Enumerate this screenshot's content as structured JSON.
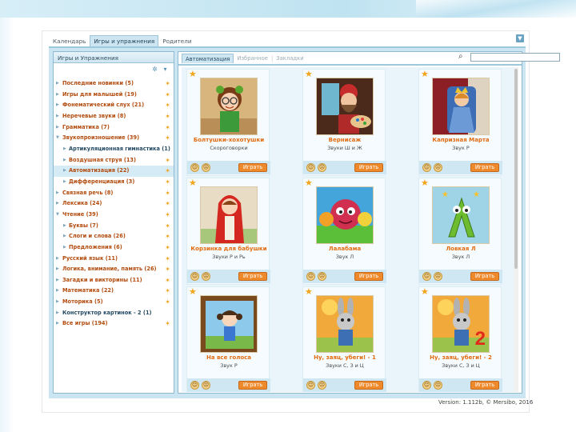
{
  "tabs": [
    "Календарь",
    "Игры и упражнения",
    "Родители"
  ],
  "help_label": "▼",
  "left_panel": {
    "title": "Игры и Упражнения",
    "items": [
      {
        "label": "Последние новинки (5)",
        "level": 0,
        "expanded": false,
        "star": true,
        "dark": false
      },
      {
        "label": "Игры для малышей (19)",
        "level": 0,
        "expanded": false,
        "star": true,
        "dark": false
      },
      {
        "label": "Фонематический слух (21)",
        "level": 0,
        "expanded": false,
        "star": true,
        "dark": false
      },
      {
        "label": "Неречевые звуки (8)",
        "level": 0,
        "expanded": false,
        "star": true,
        "dark": false
      },
      {
        "label": "Грамматика (7)",
        "level": 0,
        "expanded": false,
        "star": true,
        "dark": false
      },
      {
        "label": "Звукопроизношение (39)",
        "level": 0,
        "expanded": true,
        "star": true,
        "dark": false
      },
      {
        "label": "Артикуляционная гимнастика (1)",
        "level": 1,
        "expanded": false,
        "star": false,
        "dark": true
      },
      {
        "label": "Воздушная струя (13)",
        "level": 1,
        "expanded": false,
        "star": true,
        "dark": false
      },
      {
        "label": "Автоматизация (22)",
        "level": 1,
        "expanded": false,
        "star": true,
        "dark": false,
        "selected": true
      },
      {
        "label": "Дифференциация (3)",
        "level": 1,
        "expanded": false,
        "star": true,
        "dark": false
      },
      {
        "label": "Связная речь (8)",
        "level": 0,
        "expanded": false,
        "star": true,
        "dark": false
      },
      {
        "label": "Лексика (24)",
        "level": 0,
        "expanded": false,
        "star": true,
        "dark": false
      },
      {
        "label": "Чтение (39)",
        "level": 0,
        "expanded": true,
        "star": true,
        "dark": false
      },
      {
        "label": "Буквы (7)",
        "level": 1,
        "expanded": false,
        "star": true,
        "dark": false
      },
      {
        "label": "Слоги и слова (26)",
        "level": 1,
        "expanded": false,
        "star": true,
        "dark": false
      },
      {
        "label": "Предложения (6)",
        "level": 1,
        "expanded": false,
        "star": true,
        "dark": false
      },
      {
        "label": "Русский язык (11)",
        "level": 0,
        "expanded": false,
        "star": true,
        "dark": false
      },
      {
        "label": "Логика, внимание, память (26)",
        "level": 0,
        "expanded": false,
        "star": true,
        "dark": false
      },
      {
        "label": "Загадки и викторины (11)",
        "level": 0,
        "expanded": false,
        "star": true,
        "dark": false
      },
      {
        "label": "Математика (22)",
        "level": 0,
        "expanded": false,
        "star": true,
        "dark": false
      },
      {
        "label": "Моторика (5)",
        "level": 0,
        "expanded": false,
        "star": true,
        "dark": false
      },
      {
        "label": "Конструктор картинок - 2 (1)",
        "level": 0,
        "expanded": false,
        "star": false,
        "dark": true
      },
      {
        "label": "Все игры (194)",
        "level": 0,
        "expanded": false,
        "star": true,
        "dark": false
      }
    ]
  },
  "right_panel": {
    "tabs": [
      "Автоматизация",
      "Избранное",
      "Закладки"
    ],
    "search_placeholder": ""
  },
  "cards": [
    {
      "title": "Болтушки-хохотушки",
      "subtitle": "Скороговорки",
      "image": "girl-with-glasses",
      "button": "Играть"
    },
    {
      "title": "Вернисаж",
      "subtitle": "Звуки Ш и Ж",
      "image": "painter-with-palette",
      "button": "Играть"
    },
    {
      "title": "Капризная Марта",
      "subtitle": "Звук Р",
      "image": "princess-on-throne",
      "button": "Играть"
    },
    {
      "title": "Корзинка для бабушки",
      "subtitle": "Звуки Р и Рь",
      "image": "little-red-riding-hood",
      "button": "Играть"
    },
    {
      "title": "Лалабама",
      "subtitle": "Звук Л",
      "image": "raspberry-monster",
      "button": "Играть"
    },
    {
      "title": "Ловкая Л",
      "subtitle": "Звук Л",
      "image": "letter-l-character",
      "button": "Играть"
    },
    {
      "title": "На все голоса",
      "subtitle": "Звук Р",
      "image": "girl-in-frame",
      "button": "Играть"
    },
    {
      "title": "Ну, заяц, убеги! - 1",
      "subtitle": "Звуки С, З и Ц",
      "image": "rabbit",
      "button": "Играть"
    },
    {
      "title": "Ну, заяц, убеги! - 2",
      "subtitle": "Звуки С, З и Ц",
      "image": "rabbit-number-2",
      "button": "Играть",
      "image_text": "2"
    }
  ],
  "version": "Version: 1.112b, © Mersibo, 2016"
}
